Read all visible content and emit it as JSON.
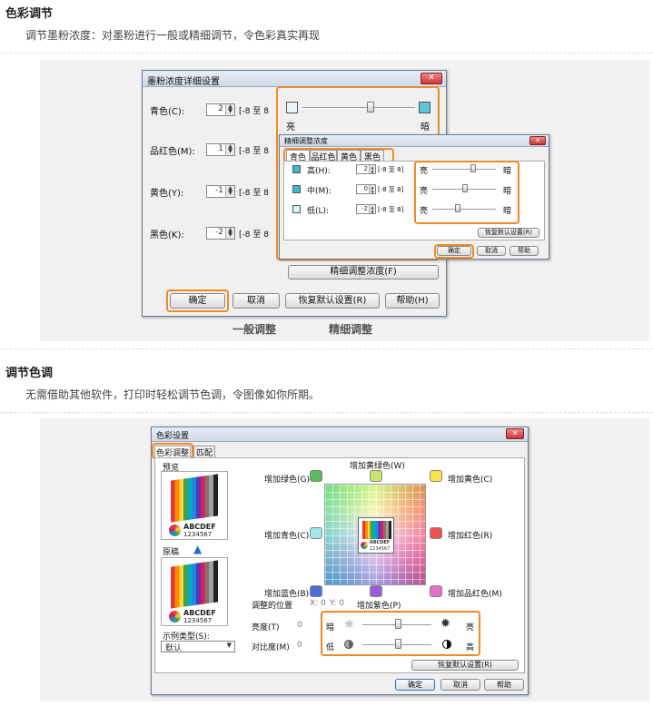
{
  "section1": {
    "title": "色彩调节",
    "desc": "调节墨粉浓度：对墨粉进行一般或精细调节，令色彩真实再现",
    "caption_general": "一般调整",
    "caption_fine": "精细调整",
    "dialog": {
      "title": "墨粉浓度详细设置",
      "close": "✕",
      "rows": [
        {
          "label": "青色(C):",
          "value": "2",
          "range": "[-8 至 8"
        },
        {
          "label": "品红色(M):",
          "value": "1",
          "range": "[-8 至 8"
        },
        {
          "label": "黄色(Y):",
          "value": "-1",
          "range": "[-8 至 8"
        },
        {
          "label": "黑色(K):",
          "value": "-2",
          "range": "[-8 至 8"
        }
      ],
      "light": "亮",
      "dark": "暗",
      "fine_button": "精细调整浓度(F)",
      "buttons": [
        "确定",
        "取消",
        "恢复默认设置(R)",
        "帮助(H)"
      ]
    },
    "fine_dialog": {
      "title": "精细调整浓度",
      "close": "✕",
      "tabs": [
        "青色",
        "品红色",
        "黄色",
        "黑色"
      ],
      "rows": [
        {
          "label": "高(H):",
          "value": "2",
          "range": "[-8 至 8]"
        },
        {
          "label": "中(M):",
          "value": "0",
          "range": "[-8 至 8]"
        },
        {
          "label": "低(L):",
          "value": "-2",
          "range": "[-8 至 8]"
        }
      ],
      "light": "亮",
      "dark": "暗",
      "restore": "恢复默认设置(R)",
      "buttons": [
        "确定",
        "取消",
        "帮助"
      ]
    }
  },
  "section2": {
    "title": "调节色调",
    "desc": "无需借助其他软件，打印时轻松调节色调，令图像如你所期。",
    "dialog": {
      "title": "色彩设置",
      "close": "✕",
      "tabs": [
        "色彩调整",
        "匹配"
      ],
      "preview": "预览",
      "original": "原稿",
      "sample_text1": "ABCDEF",
      "sample_text2": "1234567",
      "inc_yellow_green": "增加黄绿色(W)",
      "inc_green": "增加绿色(G)",
      "inc_yellow": "增加黄色(C)",
      "inc_cyan": "增加青色(C)",
      "inc_red": "增加红色(R)",
      "inc_blue": "增加蓝色(B)",
      "inc_magenta": "增加品红色(M)",
      "inc_purple": "增加紫色(P)",
      "position_label": "调整的位置",
      "position_x": "X: 0",
      "position_y": "Y: 0",
      "sample_type_label": "示例类型(S):",
      "sample_type_value": "默认",
      "brightness": {
        "label": "亮度(T)",
        "value": "0",
        "left": "暗",
        "right": "亮"
      },
      "contrast": {
        "label": "对比度(M)",
        "value": "0",
        "left": "低",
        "right": "高"
      },
      "restore": "恢复默认设置(R)",
      "buttons": [
        "确定",
        "取消",
        "帮助"
      ]
    }
  }
}
